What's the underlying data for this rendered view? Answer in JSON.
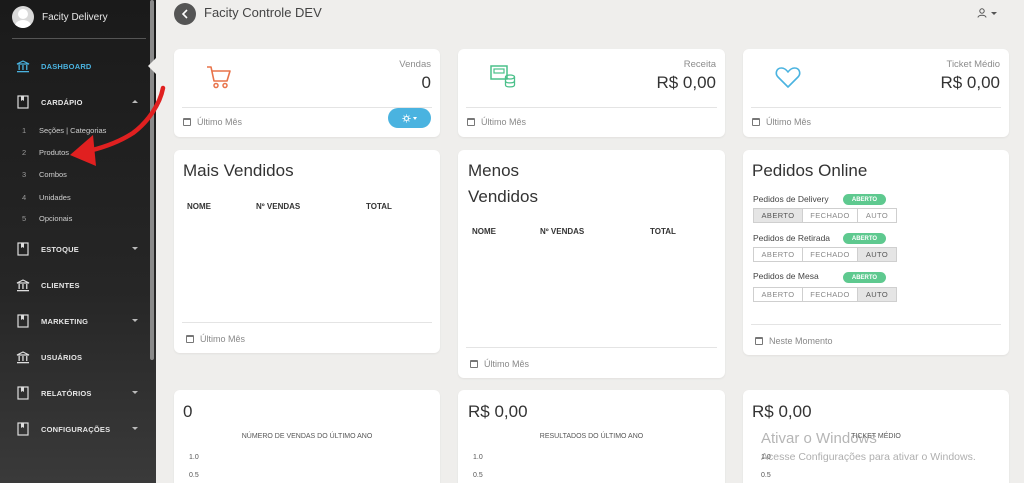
{
  "app": {
    "brand": "Facity Delivery",
    "page_title": "Facity Controle DEV"
  },
  "sidebar": {
    "items": [
      {
        "label": "DASHBOARD",
        "icon": "bank-icon",
        "active": true
      },
      {
        "label": "CARDÁPIO",
        "icon": "book-icon",
        "expanded": true
      },
      {
        "label": "ESTOQUE",
        "icon": "book-icon"
      },
      {
        "label": "CLIENTES",
        "icon": "bank-icon"
      },
      {
        "label": "MARKETING",
        "icon": "book-icon"
      },
      {
        "label": "USUÁRIOS",
        "icon": "bank-icon"
      },
      {
        "label": "RELATÓRIOS",
        "icon": "book-icon"
      },
      {
        "label": "CONFIGURAÇÕES",
        "icon": "book-icon"
      }
    ],
    "submenu": [
      {
        "num": "1",
        "label": "Seções | Categorias"
      },
      {
        "num": "2",
        "label": "Produtos"
      },
      {
        "num": "3",
        "label": "Combos"
      },
      {
        "num": "4",
        "label": "Unidades"
      },
      {
        "num": "5",
        "label": "Opcionais"
      }
    ]
  },
  "stats": [
    {
      "label": "Vendas",
      "value": "0",
      "icon": "cart-icon",
      "icon_color": "#e8734a",
      "footer": "Último Mês"
    },
    {
      "label": "Receita",
      "value": "R$ 0,00",
      "icon": "cash-register-icon",
      "icon_color": "#4ac08a",
      "footer": "Último Mês"
    },
    {
      "label": "Ticket Médio",
      "value": "R$ 0,00",
      "icon": "heart-icon",
      "icon_color": "#4ab3e0",
      "footer": "Último Mês"
    }
  ],
  "mais_vendidos": {
    "title": "Mais Vendidos",
    "columns": [
      "NOME",
      "Nº VENDAS",
      "TOTAL"
    ],
    "footer": "Último Mês"
  },
  "menos_vendidos": {
    "title_line1": "Menos",
    "title_line2": "Vendidos",
    "columns": [
      "NOME",
      "Nº VENDAS",
      "TOTAL"
    ],
    "footer": "Último Mês"
  },
  "pedidos_online": {
    "title": "Pedidos Online",
    "rows": [
      {
        "label": "Pedidos de Delivery",
        "badge": "ABERTO",
        "options": [
          "ABERTO",
          "FECHADO",
          "AUTO"
        ],
        "selected": 0
      },
      {
        "label": "Pedidos de Retirada",
        "badge": "ABERTO",
        "options": [
          "ABERTO",
          "FECHADO",
          "AUTO"
        ],
        "selected": 2
      },
      {
        "label": "Pedidos de Mesa",
        "badge": "ABERTO",
        "options": [
          "ABERTO",
          "FECHADO",
          "AUTO"
        ],
        "selected": 2
      }
    ],
    "footer": "Neste Momento"
  },
  "bottom_charts": [
    {
      "value": "0",
      "caption": "NÚMERO DE VENDAS DO ÚLTIMO ANO",
      "ticks": [
        "1.0",
        "0.5"
      ]
    },
    {
      "value": "R$ 0,00",
      "caption": "RESULTADOS DO ÚLTIMO ANO",
      "ticks": [
        "1.0",
        "0.5"
      ]
    },
    {
      "value": "R$ 0,00",
      "caption": "TICKET MÉDIO",
      "ticks": [
        "1.0",
        "0.5"
      ]
    }
  ],
  "watermark": {
    "title": "Ativar o Windows",
    "subtitle": "Acesse Configurações para ativar o Windows."
  },
  "colors": {
    "accent": "#4ab3e0",
    "badge_green": "#5ec98f",
    "arrow_red": "#e02020"
  }
}
